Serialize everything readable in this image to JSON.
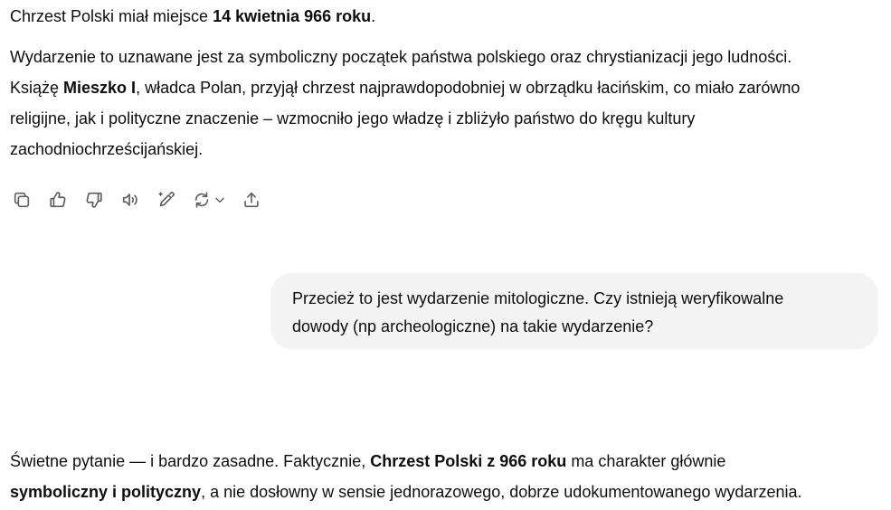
{
  "assistant_msg_1": {
    "p1": {
      "pre": "Chrzest Polski miał miejsce ",
      "bold": "14 kwietnia 966 roku",
      "post": "."
    },
    "p2": {
      "line1": "Wydarzenie to uznawane jest za symboliczny początek państwa polskiego oraz chrystianizacji jego ludności.",
      "line2_pre": "Książę ",
      "line2_bold": "Mieszko I",
      "line2_post": ", władca Polan, przyjął chrzest najprawdopodobniej w obrządku łacińskim, co miało zarówno",
      "line3": "religijne, jak i polityczne znaczenie – wzmocniło jego władzę i zbliżyło państwo do kręgu kultury",
      "line4": "zachodniochrześcijańskiej."
    }
  },
  "message_actions": {
    "icons": [
      "copy-icon",
      "thumbs-up-icon",
      "thumbs-down-icon",
      "read-aloud-icon",
      "edit-icon",
      "regenerate-icon",
      "chevron-down-icon",
      "share-icon"
    ]
  },
  "user_msg": {
    "line1": "Przecież to jest wydarzenie mitologiczne. Czy istnieją weryfikowalne",
    "line2": "dowody (np archeologiczne) na takie wydarzenie?"
  },
  "assistant_msg_2": {
    "line1_pre": "Świetne pytanie — i bardzo zasadne. Faktycznie, ",
    "line1_bold": "Chrzest Polski z 966 roku",
    "line1_post": " ma charakter głównie",
    "line2_bold": "symboliczny i polityczny",
    "line2_post": ", a nie dosłowny w sensie jednorazowego, dobrze udokumentowanego wydarzenia."
  },
  "colors": {
    "text": "#0d0d0d",
    "icon": "#5d5d5d",
    "bubble_bg": "#f4f4f4"
  }
}
